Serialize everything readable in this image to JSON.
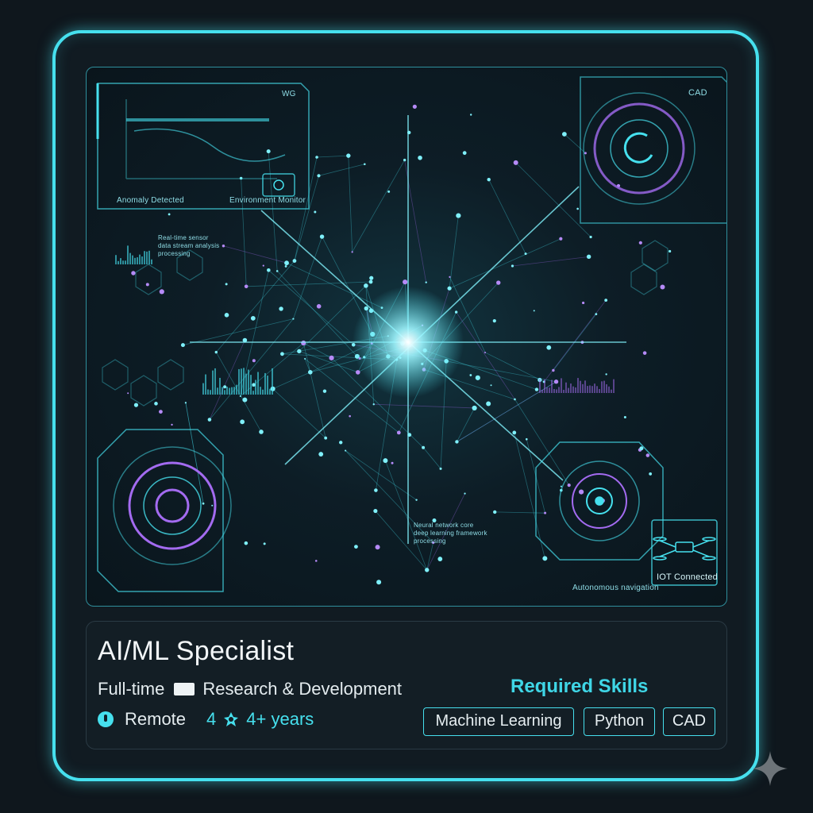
{
  "hero": {
    "labels": {
      "top_left_corner": "WG",
      "top_left_status": "Anomaly Detected",
      "top_left_status2": "Environment Monitor",
      "top_right_corner": "CAD",
      "left_text_1": "Real-time sensor",
      "left_text_2": "data stream analysis",
      "left_text_3": "processing",
      "center_text_1": "Neural network core",
      "center_text_2": "deep learning framework",
      "center_text_3": "processing",
      "bottom_right_status": "Autonomous navigation",
      "iot_status": "IOT Connected"
    }
  },
  "job": {
    "title": "AI/ML Specialist",
    "employment_type": "Full-time",
    "department": "Research & Development",
    "location": "Remote",
    "experience_prefix": "4",
    "experience": "4+ years"
  },
  "skills": {
    "heading": "Required Skills",
    "items": [
      "Machine Learning",
      "Python",
      "CAD"
    ]
  },
  "icons": {
    "location": "location-pin-icon",
    "experience": "experience-badge-icon",
    "department_separator": "briefcase-icon",
    "sparkle": "sparkle-icon",
    "drone": "drone-icon"
  },
  "colors": {
    "accent": "#46e0ee",
    "accent_purple": "#a36bf0",
    "background": "#0f171d"
  }
}
